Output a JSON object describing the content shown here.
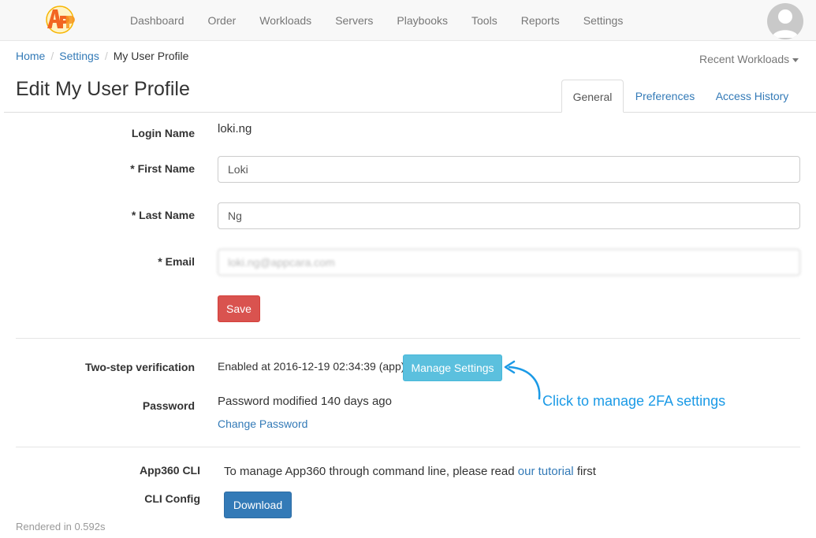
{
  "nav": {
    "logo_text": "App",
    "items": [
      "Dashboard",
      "Order",
      "Workloads",
      "Servers",
      "Playbooks",
      "Tools",
      "Reports",
      "Settings"
    ]
  },
  "breadcrumb": {
    "home": "Home",
    "settings": "Settings",
    "current": "My User Profile"
  },
  "recent_workloads": "Recent Workloads",
  "page_title": "Edit My User Profile",
  "tabs": {
    "general": "General",
    "preferences": "Preferences",
    "access_history": "Access History"
  },
  "form": {
    "login_name_label": "Login Name",
    "login_name_value": "loki.ng",
    "first_name_label": "* First Name",
    "first_name_value": "Loki",
    "last_name_label": "* Last Name",
    "last_name_value": "Ng",
    "email_label": "* Email",
    "email_value": "loki.ng@appcara.com",
    "save_label": "Save"
  },
  "security": {
    "two_step_label": "Two-step verification",
    "two_step_status": "Enabled at 2016-12-19 02:34:39 (app).",
    "manage_settings_label": "Manage Settings",
    "password_label": "Password",
    "password_status": "Password modified 140 days ago",
    "change_password_label": "Change Password",
    "annotation": "Click to manage 2FA settings"
  },
  "cli": {
    "app_cli_label": "App360 CLI",
    "description_prefix": "To manage App360 through command line, please read",
    "tutorial_link": "our tutorial",
    "description_suffix": "first",
    "config_label": "CLI Config",
    "download_label": "Download"
  },
  "footer": "Rendered in 0.592s",
  "colors": {
    "link": "#337ab7",
    "danger": "#d9534f",
    "info": "#5bc0de",
    "primary": "#337ab7",
    "annotation": "#1b9ae6"
  }
}
